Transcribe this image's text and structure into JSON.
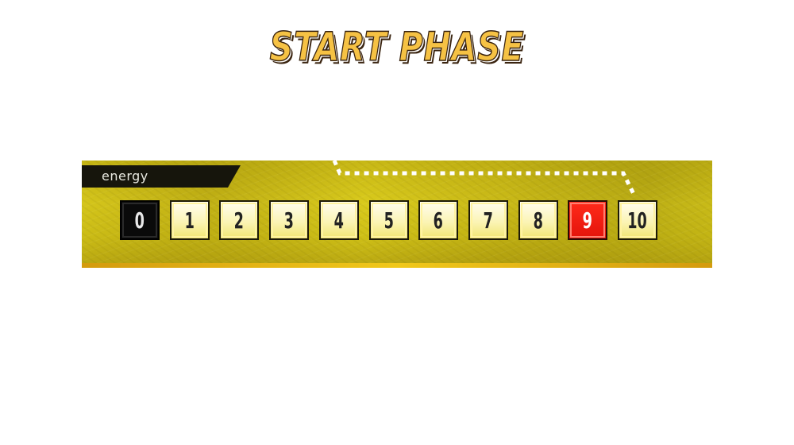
{
  "phase": {
    "title": "START PHASE"
  },
  "energy": {
    "label": "energy",
    "current": 9,
    "track": [
      "0",
      "1",
      "2",
      "3",
      "4",
      "5",
      "6",
      "7",
      "8",
      "9",
      "10"
    ]
  },
  "colors": {
    "panel": "#d9ca1c",
    "cell": "#fbf4b5",
    "current": "#e3140b",
    "zero": "#0a0a0a",
    "title": "#f6c244"
  }
}
